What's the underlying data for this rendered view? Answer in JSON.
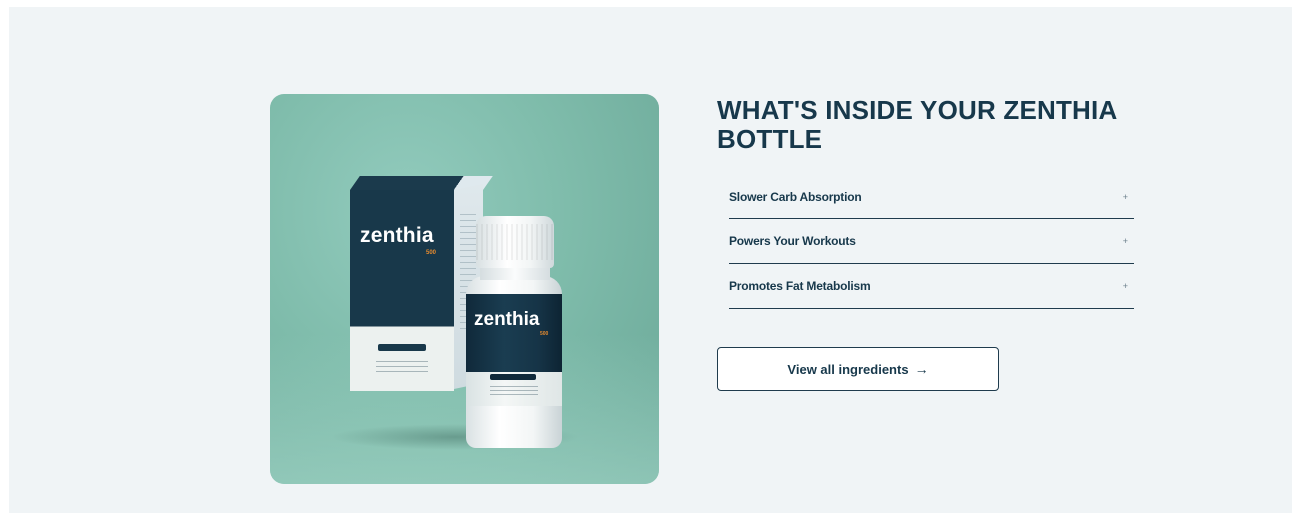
{
  "product": {
    "image_alt": "Zenthia 500 supplement box and bottle",
    "box_brand": "zenthia",
    "box_num": "500",
    "bottle_brand": "zenthia",
    "bottle_num": "500"
  },
  "section": {
    "heading": "WHAT'S INSIDE YOUR ZENTHIA BOTTLE"
  },
  "accordion": {
    "items": [
      {
        "label": "Slower Carb Absorption",
        "icon": "plus-icon",
        "expanded": false
      },
      {
        "label": "Powers Your Workouts",
        "icon": "plus-icon",
        "expanded": false
      },
      {
        "label": "Promotes Fat Metabolism",
        "icon": "plus-icon",
        "expanded": false
      }
    ],
    "toggle_symbol": "+"
  },
  "cta": {
    "label": "View all ingredients",
    "arrow": "→"
  },
  "colors": {
    "page_bg": "#f0f4f6",
    "heading": "#17384b",
    "image_bg": "#7fbcab",
    "accent_orange": "#e48a2f"
  }
}
